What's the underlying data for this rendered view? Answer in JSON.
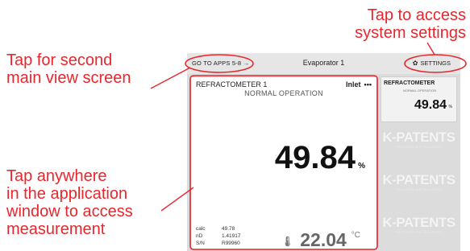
{
  "callouts": {
    "settings": [
      "Tap to access",
      "system settings"
    ],
    "second_view": [
      "Tap for second",
      "main view screen"
    ],
    "application": [
      "Tap anywhere",
      "in the application",
      "window to access",
      "measurement"
    ]
  },
  "topbar": {
    "apps_link": "GO TO APPS 5-8 →",
    "title": "Evaporator 1",
    "settings_label": "SETTINGS"
  },
  "main_panel": {
    "title": "REFRACTOMETER 1",
    "location": "Inlet",
    "menu": "•••",
    "status": "NORMAL OPERATION",
    "value": "49.84",
    "unit": "%",
    "meta": [
      {
        "key": "calc",
        "value": "49.78"
      },
      {
        "key": "nD",
        "value": "1.41917"
      },
      {
        "key": "S/N",
        "value": "R99960"
      }
    ],
    "temperature": "22.04",
    "temperature_unit": "°C"
  },
  "side_panel": {
    "title": "REFRACTOMETER",
    "status": "NORMAL OPERATION",
    "value": "49.84",
    "unit": "%"
  },
  "logos": [
    {
      "name": "K-PATENTS",
      "tagline": "PROCESS INSTRUMENTS"
    },
    {
      "name": "K-PATENTS",
      "tagline": "PROCESS INSTRUMENTS"
    },
    {
      "name": "K-PATENTS",
      "tagline": "PROCESS INSTRUMENTS"
    }
  ],
  "colors": {
    "annotation": "#e8262d",
    "screen_bg": "#dcdcdc"
  }
}
